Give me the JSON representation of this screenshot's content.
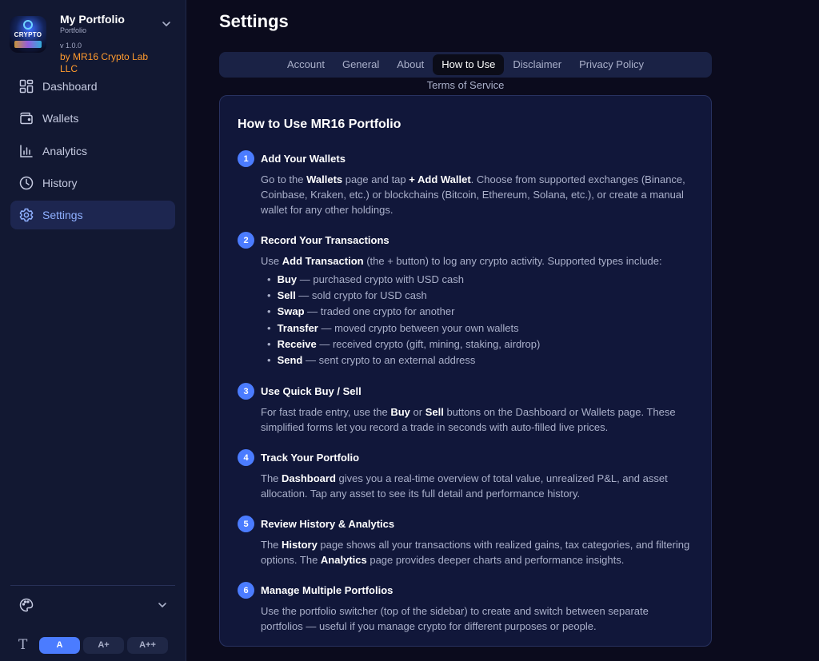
{
  "portfolio": {
    "name": "My Portfolio",
    "subtitle": "Portfolio",
    "version": "v 1.0.0",
    "byline": "by MR16 Crypto Lab LLC",
    "logo_text": "CRYPTO"
  },
  "nav": {
    "dashboard": "Dashboard",
    "wallets": "Wallets",
    "analytics": "Analytics",
    "history": "History",
    "settings": "Settings"
  },
  "footer": {
    "font_sizes": {
      "normal": "A",
      "large": "A+",
      "xlarge": "A++"
    },
    "font_icon": "T"
  },
  "page": {
    "title": "Settings"
  },
  "tabs": {
    "account": "Account",
    "general": "General",
    "about": "About",
    "how_to_use": "How to Use",
    "disclaimer": "Disclaimer",
    "privacy": "Privacy Policy",
    "terms": "Terms of Service"
  },
  "guide": {
    "title": "How to Use MR16 Portfolio",
    "s1": {
      "num": "1",
      "title": "Add Your Wallets",
      "t1": "Go to the ",
      "b1": "Wallets",
      "t2": " page and tap ",
      "b2": "+ Add Wallet",
      "t3": ". Choose from supported exchanges (Binance, Coinbase, Kraken, etc.) or blockchains (Bitcoin, Ethereum, Solana, etc.), or create a manual wallet for any other holdings."
    },
    "s2": {
      "num": "2",
      "title": "Record Your Transactions",
      "t1": "Use ",
      "b1": "Add Transaction",
      "t2": " (the + button) to log any crypto activity. Supported types include:",
      "bullets": [
        {
          "term": "Buy",
          "desc": " — purchased crypto with USD cash"
        },
        {
          "term": "Sell",
          "desc": " — sold crypto for USD cash"
        },
        {
          "term": "Swap",
          "desc": " — traded one crypto for another"
        },
        {
          "term": "Transfer",
          "desc": " — moved crypto between your own wallets"
        },
        {
          "term": "Receive",
          "desc": " — received crypto (gift, mining, staking, airdrop)"
        },
        {
          "term": "Send",
          "desc": " — sent crypto to an external address"
        }
      ]
    },
    "s3": {
      "num": "3",
      "title": "Use Quick Buy / Sell",
      "t1": "For fast trade entry, use the ",
      "b1": "Buy",
      "t2": " or ",
      "b2": "Sell",
      "t3": " buttons on the Dashboard or Wallets page. These simplified forms let you record a trade in seconds with auto-filled live prices."
    },
    "s4": {
      "num": "4",
      "title": "Track Your Portfolio",
      "t1": "The ",
      "b1": "Dashboard",
      "t2": " gives you a real-time overview of total value, unrealized P&L, and asset allocation. Tap any asset to see its full detail and performance history."
    },
    "s5": {
      "num": "5",
      "title": "Review History & Analytics",
      "t1": "The ",
      "b1": "History",
      "t2": " page shows all your transactions with realized gains, tax categories, and filtering options. The ",
      "b2": "Analytics",
      "t3": " page provides deeper charts and performance insights."
    },
    "s6": {
      "num": "6",
      "title": "Manage Multiple Portfolios",
      "t1": "Use the portfolio switcher (top of the sidebar) to create and switch between separate portfolios — useful if you manage crypto for different purposes or people."
    }
  },
  "icons": {
    "dashboard": "grid-icon",
    "wallets": "wallet-icon",
    "analytics": "bar-chart-icon",
    "history": "clock-icon",
    "settings": "gear-icon",
    "theme": "palette-icon",
    "chevron": "chevron-down-icon"
  },
  "colors": {
    "accent": "#4b7cff",
    "byline": "#ff9a2e",
    "sidebar_bg": "#121832",
    "page_bg": "#0b0b1d",
    "card_bg": "#11173a"
  }
}
